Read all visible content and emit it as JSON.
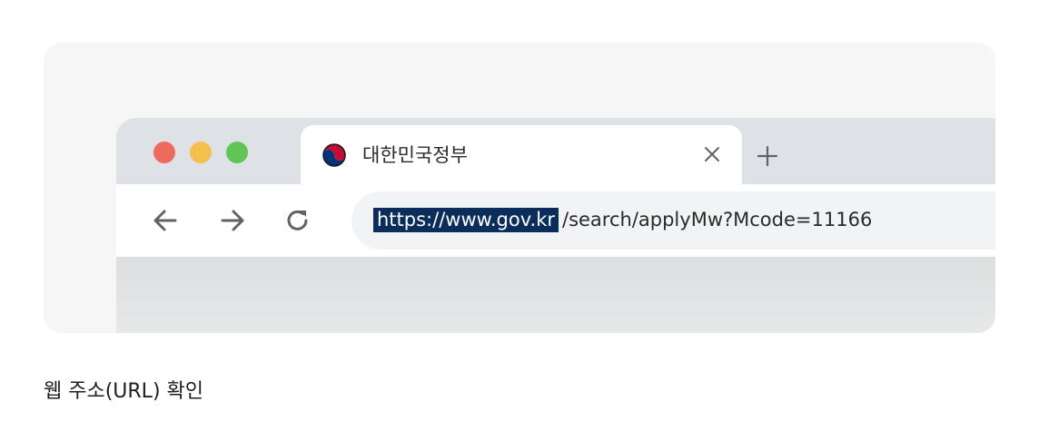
{
  "tab": {
    "title": "대한민국정부",
    "favicon": "taegeuk-icon"
  },
  "toolbar": {
    "back_icon": "back-arrow-icon",
    "forward_icon": "forward-arrow-icon",
    "reload_icon": "reload-icon"
  },
  "address_bar": {
    "highlighted_host": "https://www.gov.kr",
    "path": "/search/applyMw?Mcode=11166"
  },
  "caption": "웹 주소(URL) 확인",
  "colors": {
    "traffic_red": "#ed6a5e",
    "traffic_yellow": "#f5bf4f",
    "traffic_green": "#61c554",
    "highlight": "#0b2d5b"
  }
}
